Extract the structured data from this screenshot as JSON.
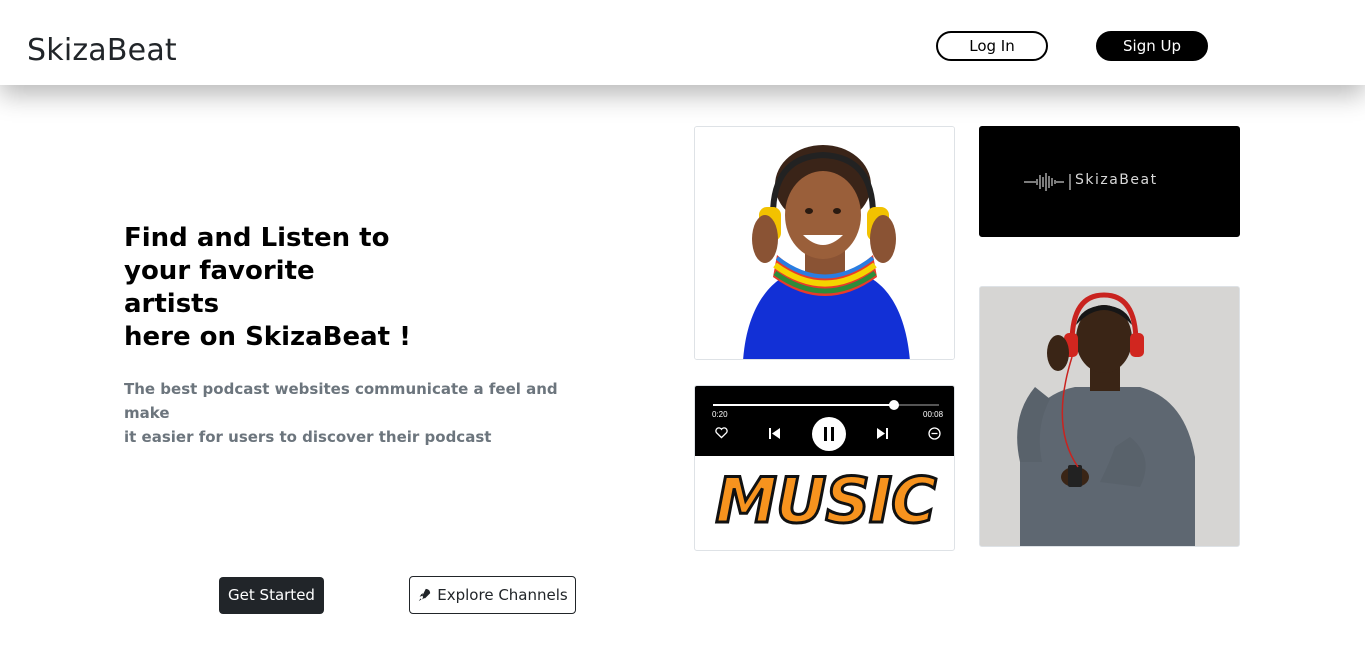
{
  "nav": {
    "brand": "SkizaBeat",
    "login_label": "Log In",
    "signup_label": "Sign Up"
  },
  "hero": {
    "headline_lines": [
      "Find and Listen to",
      "your favorite artists",
      "here on SkizaBeat !"
    ],
    "subtext_lines": [
      "The best podcast websites communicate a feel and make",
      "it easier for users to discover their podcast"
    ],
    "get_started_label": "Get Started",
    "explore_label": "Explore Channels",
    "explore_icon": "rocket-icon"
  },
  "gallery": {
    "logo_text": "SkizaBeat",
    "player": {
      "elapsed": "0:20",
      "remaining": "00:08",
      "progress": 0.8
    },
    "music_text": "MUSIC"
  },
  "colors": {
    "primary_dark": "#212529",
    "muted_text": "#6c757d",
    "music_orange": "#f7931e"
  }
}
